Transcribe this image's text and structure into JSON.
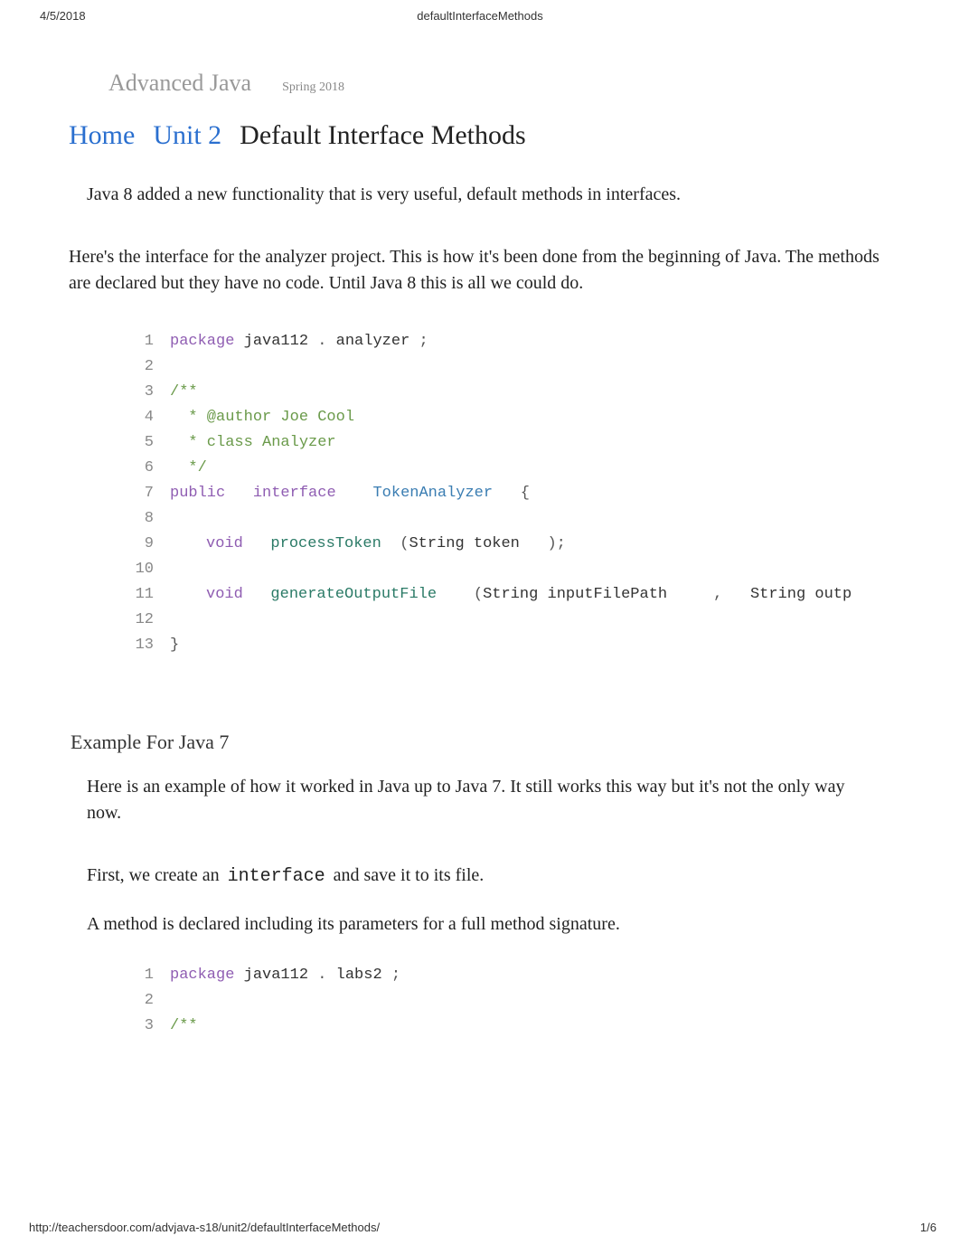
{
  "print_header": {
    "date": "4/5/2018",
    "title": "defaultInterfaceMethods"
  },
  "course": {
    "name": "Advanced Java",
    "term": "Spring 2018"
  },
  "breadcrumb": {
    "home": "Home",
    "unit": "Unit 2",
    "current": "Default Interface Methods"
  },
  "intro_text": "Java 8 added a new functionality that is very useful, default methods in interfaces.",
  "para_text": "Here's the interface for the analyzer project. This is how it's been done from the beginning of Java. The methods are declared but they have no code. Until Java 8 this is all we could do.",
  "code1": {
    "l1": {
      "n": "1",
      "kw": "package",
      "pkg1": " java112 ",
      "dot": ".",
      "pkg2": " analyzer ",
      "semi": ";"
    },
    "l2": {
      "n": "2"
    },
    "l3": {
      "n": "3",
      "doc": "/**"
    },
    "l4": {
      "n": "4",
      "doc": "  * @author Joe Cool"
    },
    "l5": {
      "n": "5",
      "doc": "  * class Analyzer"
    },
    "l6": {
      "n": "6",
      "doc": "  */"
    },
    "l7": {
      "n": "7",
      "public": "public",
      "interface": " interface",
      "name": "TokenAnalyzer",
      "brace": "{"
    },
    "l8": {
      "n": "8"
    },
    "l9": {
      "n": "9",
      "void": "void",
      "fn": " processToken",
      "lp": "(",
      "arg": "String token",
      "rp": ");"
    },
    "l10": {
      "n": "10"
    },
    "l11": {
      "n": "11",
      "void": "void",
      "fn": " generateOutputFile",
      "lp": "(",
      "arg1": "String inputFilePath",
      "comma": ",",
      "arg2": " String outp"
    },
    "l12": {
      "n": "12"
    },
    "l13": {
      "n": "13",
      "brace": "}"
    }
  },
  "section_h2": "Example For Java 7",
  "intro2_text": "Here is an example of how it worked in Java up to Java 7. It still works this way but it's not the only way now.",
  "para2_prefix": "First, we create an ",
  "para2_code": "interface",
  "para2_suffix": " and save it to its file.",
  "para3_text": "A method is declared including its parameters for a full method signature.",
  "code2": {
    "l1": {
      "n": "1",
      "kw": "package",
      "pkg1": " java112 ",
      "dot": ".",
      "pkg2": " labs2 ",
      "semi": ";"
    },
    "l2": {
      "n": "2"
    },
    "l3": {
      "n": "3",
      "doc": "/**"
    }
  },
  "print_footer": {
    "url": "http://teachersdoor.com/advjava-s18/unit2/defaultInterfaceMethods/",
    "page": "1/6"
  }
}
